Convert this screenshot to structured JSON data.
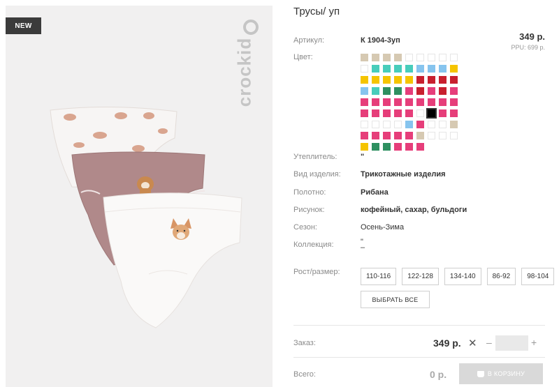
{
  "badge": "NEW",
  "brand": "crockid",
  "product": {
    "title": "Трусы/ уп",
    "article_label": "Артикул:",
    "article_value": "К 1904-3уп",
    "price": "349 р.",
    "ppu": "PPU: 699 р.",
    "color_label": "Цвет:",
    "insulation_label": "Утеплитель:",
    "insulation_value": "\"",
    "type_label": "Вид изделия:",
    "type_value": "Трикотажные изделия",
    "fabric_label": "Полотно:",
    "fabric_value": "Рибана",
    "pattern_label": "Рисунок:",
    "pattern_value": "кофейный, сахар, бульдоги",
    "season_label": "Сезон:",
    "season_value": "Осень-Зима",
    "collection_label": "Коллекция:",
    "collection_value_1": "\"",
    "collection_value_2": "–",
    "size_label": "Рост/размер:",
    "sizes": [
      "110-116",
      "122-128",
      "134-140",
      "86-92",
      "98-104"
    ],
    "select_all": "ВЫБРАТЬ ВСЕ"
  },
  "order": {
    "label": "Заказ:",
    "price": "349 р.",
    "remove_symbol": "✕",
    "minus_symbol": "–",
    "plus_symbol": "+",
    "quantity": ""
  },
  "total": {
    "label": "Всего:",
    "price": "0 р.",
    "cart_button": "В КОРЗИНУ"
  },
  "colors": {
    "beige": "#d6c9b2",
    "white": "#ffffff",
    "teal": "#48cdbb",
    "yellow": "#f5c400",
    "blue": "#86c4ee",
    "red": "#c8202f",
    "green": "#2e9060",
    "pink": "#e63e7a",
    "black": "#000000"
  },
  "swatch_rows": [
    [
      "beige",
      "beige",
      "beige",
      "beige",
      "white",
      "white",
      "white",
      "white",
      "white"
    ],
    [
      "white",
      "teal",
      "teal",
      "teal",
      "teal",
      "blue",
      "blue",
      "blue",
      "yellow"
    ],
    [
      "yellow",
      "yellow",
      "yellow",
      "yellow",
      "yellow",
      "red",
      "red",
      "red",
      "red"
    ],
    [
      "blue",
      "teal",
      "green",
      "green",
      "pink",
      "red",
      "pink",
      "red",
      "pink"
    ],
    [
      "pink",
      "pink",
      "pink",
      "pink",
      "pink",
      "pink",
      "pink",
      "pink",
      "pink"
    ],
    [
      "pink",
      "pink",
      "pink",
      "pink",
      "pink",
      "white",
      "black",
      "pink",
      "pink"
    ],
    [
      "white",
      "white",
      "white",
      "white",
      "blue",
      "pink",
      "white",
      "white",
      "beige"
    ],
    [
      "pink",
      "pink",
      "pink",
      "pink",
      "pink",
      "beige",
      "white",
      "white",
      "white"
    ],
    [
      "yellow",
      "green",
      "green",
      "pink",
      "pink",
      "pink"
    ]
  ],
  "selected_swatch": "black"
}
